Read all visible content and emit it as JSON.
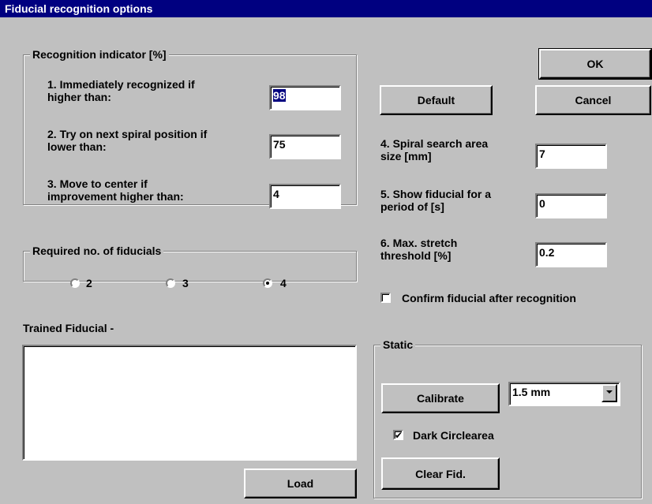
{
  "window": {
    "title": "Fiducial recognition options"
  },
  "recognition": {
    "title": "Recognition indicator [%]",
    "item1_line1": "1. Immediately recognized if",
    "item1_line2": "higher than:",
    "item1_value": "98",
    "item2_line1": "2. Try on next spiral position if",
    "item2_line2": "lower than:",
    "item2_value": "75",
    "item3_line1": "3. Move to center if",
    "item3_line2": "improvement higher than:",
    "item3_value": "4"
  },
  "required": {
    "title": "Required no. of fiducials",
    "options": [
      "2",
      "3",
      "4"
    ],
    "selected": "4"
  },
  "trained": {
    "label": "Trained Fiducial -",
    "load": "Load"
  },
  "buttons": {
    "ok": "OK",
    "cancel": "Cancel",
    "default": "Default"
  },
  "settings": {
    "item4_line1": "4. Spiral search area",
    "item4_line2": "size [mm]",
    "item4_value": "7",
    "item5_line1": "5. Show fiducial for a",
    "item5_line2": "period of [s]",
    "item5_value": "0",
    "item6_line1": "6. Max. stretch",
    "item6_line2": "threshold [%]",
    "item6_value": "0.2",
    "confirm_label": "Confirm fiducial after recognition",
    "confirm_checked": false
  },
  "static": {
    "title": "Static",
    "calibrate": "Calibrate",
    "size_value": "1.5 mm",
    "dark_label": "Dark Circlearea",
    "dark_checked": true,
    "clear": "Clear Fid."
  }
}
